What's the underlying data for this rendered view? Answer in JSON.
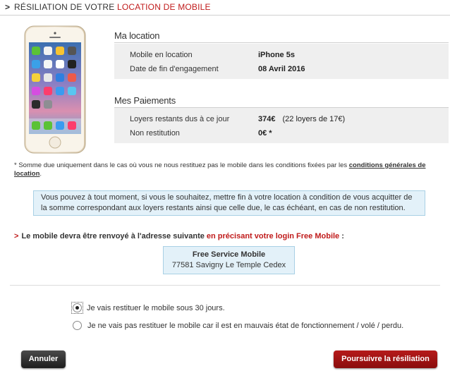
{
  "header": {
    "arrow": ">",
    "title_part1": "RÉSILIATION DE VOTRE ",
    "title_part2": "LOCATION DE MOBILE"
  },
  "location_section": {
    "title": "Ma location",
    "rows": [
      {
        "label": "Mobile en location",
        "value": "iPhone 5s"
      },
      {
        "label": "Date de fin d'engagement",
        "value": "08 Avril 2016"
      }
    ]
  },
  "payments_section": {
    "title": "Mes Paiements",
    "rows": [
      {
        "label": "Loyers restants dus à ce jour",
        "value": "374€",
        "detail": "(22 loyers de 17€)"
      },
      {
        "label": "Non restitution",
        "value": "0€ *",
        "detail": ""
      }
    ]
  },
  "footnote": {
    "text": "* Somme due uniquement dans le cas où vous ne nous restituez pas le mobile dans les conditions fixées par les ",
    "link": "conditions générales de location",
    "end": "."
  },
  "info_text": "Vous pouvez à tout moment, si vous le souhaitez, mettre fin à votre location à condition de vous acquitter de la somme correspondant aux loyers restants ainsi que celle due, le cas échéant, en cas de non restitution.",
  "shipping": {
    "marker": ">",
    "text": "Le mobile devra être renvoyé à l'adresse suivante ",
    "highlight": "en précisant votre login Free Mobile",
    "end": " :"
  },
  "address": {
    "line1": "Free Service Mobile",
    "line2": "77581 Savigny Le Temple Cedex"
  },
  "options": [
    {
      "label": "Je vais restituer le mobile sous 30 jours.",
      "selected": true
    },
    {
      "label": "Je ne vais pas restituer le mobile car il est en mauvais état de fonctionnement / volé / perdu.",
      "selected": false
    }
  ],
  "buttons": {
    "cancel": "Annuler",
    "continue": "Poursuivre la résiliation"
  },
  "colors": {
    "accent_red": "#c01b1b",
    "info_bg": "#e3f1f9",
    "info_border": "#a9d0e5",
    "row_bg": "#efefef"
  }
}
